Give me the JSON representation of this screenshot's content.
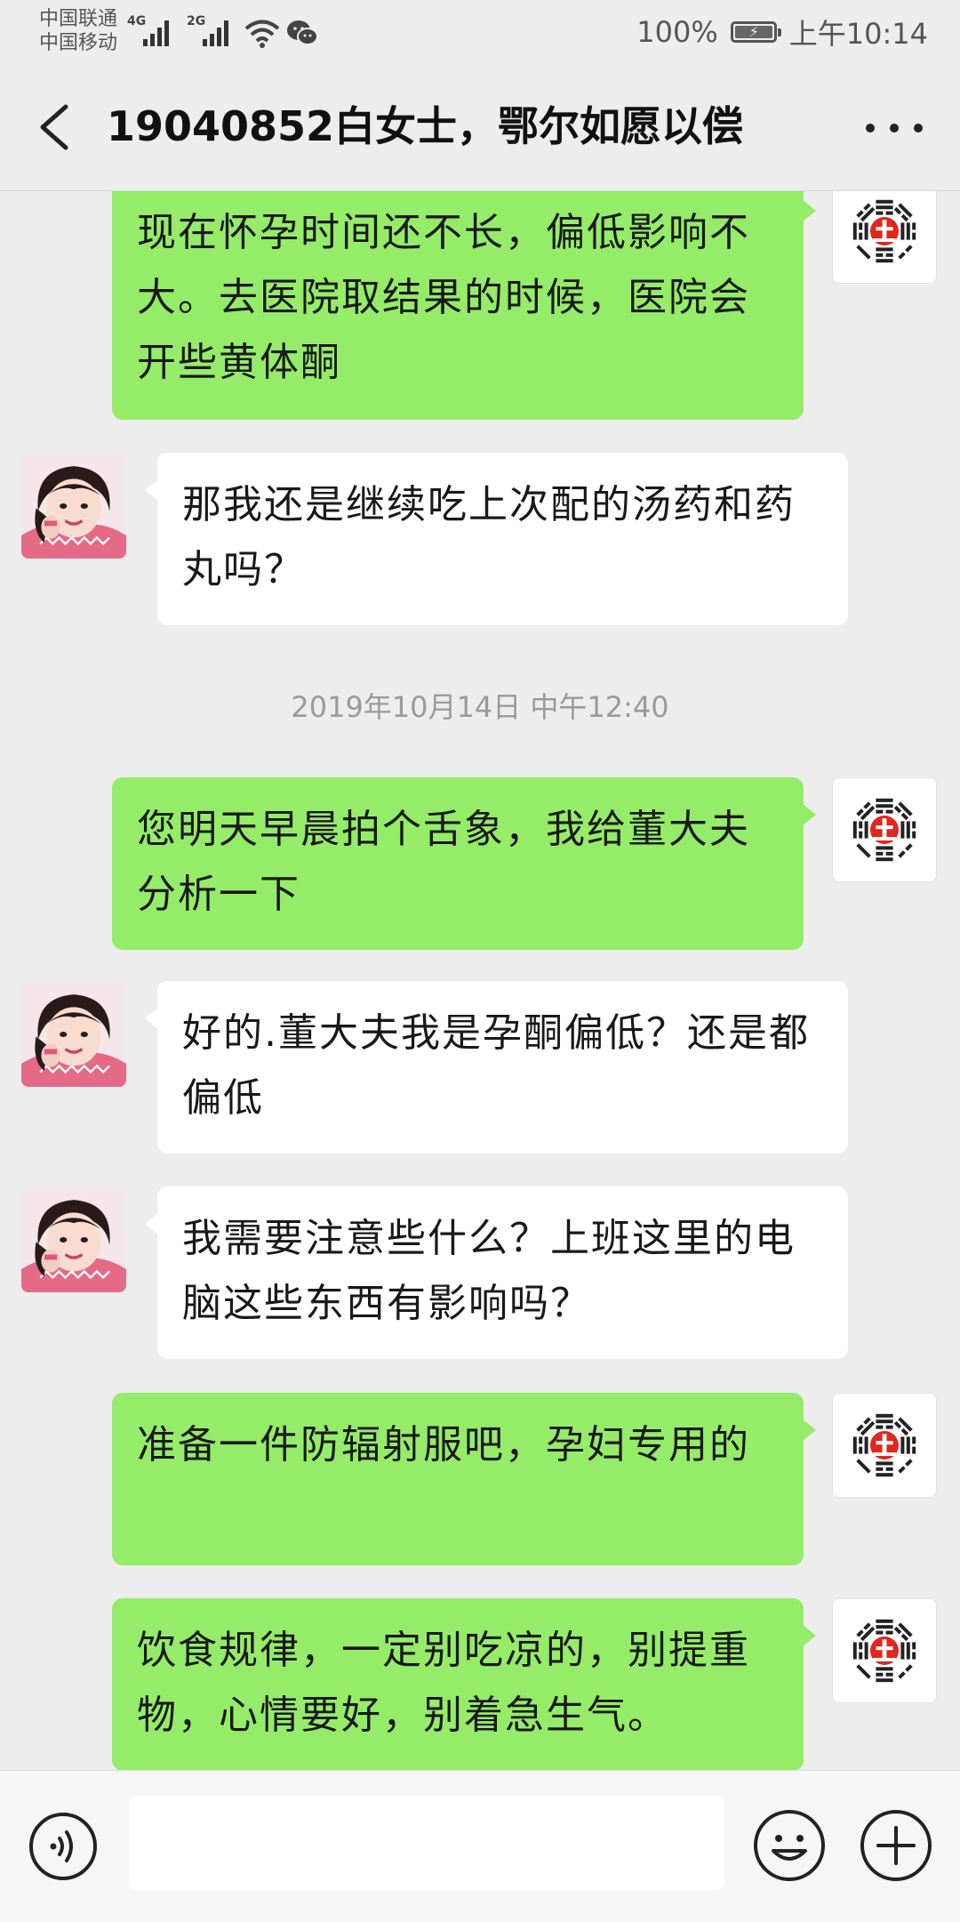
{
  "status_bar": {
    "carrier_1": "中国联通",
    "carrier_2": "中国移动",
    "network_1": "4G",
    "network_2": "2G",
    "battery": "100%",
    "time": "上午10:14"
  },
  "header": {
    "title": "19040852白女士，鄂尔如愿以偿",
    "back_icon": "chevron-left-icon",
    "more_icon": "more-horizontal-icon"
  },
  "messages": [
    {
      "sender": "me",
      "text": "现在怀孕时间还不长，偏低影响不大。去医院取结果的时候，医院会开些黄体酮"
    },
    {
      "sender": "them",
      "text": "那我还是继续吃上次配的汤药和药丸吗？"
    },
    {
      "type": "timestamp",
      "text": "2019年10月14日 中午12:40"
    },
    {
      "sender": "me",
      "text": "您明天早晨拍个舌象，我给董大夫分析一下"
    },
    {
      "sender": "them",
      "text": "好的.董大夫我是孕酮偏低？还是都偏低"
    },
    {
      "sender": "them",
      "text": "我需要注意些什么？上班这里的电脑这些东西有影响吗？"
    },
    {
      "sender": "me",
      "text": "准备一件防辐射服吧，孕妇专用的"
    },
    {
      "sender": "me",
      "text": "饮食规律，一定别吃凉的，别提重物，心情要好，别着急生气。"
    }
  ],
  "input_bar": {
    "voice_icon": "voice-icon",
    "input_value": "",
    "emoji_icon": "emoji-icon",
    "plus_icon": "plus-icon"
  },
  "colors": {
    "background": "#ededed",
    "my_bubble": "#95ec69",
    "their_bubble": "#ffffff",
    "logo_red": "#e0261d"
  }
}
